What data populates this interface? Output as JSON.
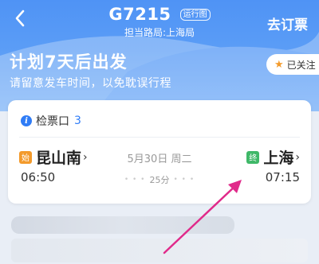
{
  "header": {
    "back_icon": "chevron-left-icon",
    "train_number": "G7215",
    "schedule_tag": "运行图",
    "bureau": "担当路局:上海局",
    "book_label": "去订票"
  },
  "hero": {
    "headline": "计划7天后出发",
    "subline": "请留意发车时间，以免耽误行程"
  },
  "follow": {
    "icon": "star-icon",
    "label": "已关注"
  },
  "card": {
    "gate_icon": "info-icon",
    "gate_icon_glyph": "i",
    "gate_label": "检票口",
    "gate_value": "3",
    "from": {
      "badge": "始",
      "name": "昆山南",
      "chevron": "›",
      "time": "06:50"
    },
    "to": {
      "badge": "终",
      "name": "上海",
      "chevron": "›",
      "time": "07:15"
    },
    "date": "5月30日 周二",
    "duration": "25分",
    "dots_left": "• • •",
    "dots_right": "• • •"
  },
  "colors": {
    "hero": "#5b9df6",
    "accent_blue": "#2f7cf6",
    "start_badge": "#f39a2b",
    "end_badge": "#3fb868",
    "arrow": "#e02a8a"
  }
}
